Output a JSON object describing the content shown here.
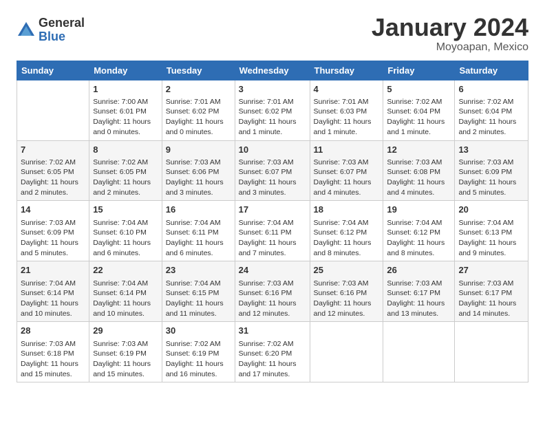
{
  "header": {
    "logo": {
      "general": "General",
      "blue": "Blue"
    },
    "month": "January 2024",
    "location": "Moyoapan, Mexico"
  },
  "weekdays": [
    "Sunday",
    "Monday",
    "Tuesday",
    "Wednesday",
    "Thursday",
    "Friday",
    "Saturday"
  ],
  "weeks": [
    [
      {
        "day": "",
        "info": ""
      },
      {
        "day": "1",
        "info": "Sunrise: 7:00 AM\nSunset: 6:01 PM\nDaylight: 11 hours\nand 0 minutes."
      },
      {
        "day": "2",
        "info": "Sunrise: 7:01 AM\nSunset: 6:02 PM\nDaylight: 11 hours\nand 0 minutes."
      },
      {
        "day": "3",
        "info": "Sunrise: 7:01 AM\nSunset: 6:02 PM\nDaylight: 11 hours\nand 1 minute."
      },
      {
        "day": "4",
        "info": "Sunrise: 7:01 AM\nSunset: 6:03 PM\nDaylight: 11 hours\nand 1 minute."
      },
      {
        "day": "5",
        "info": "Sunrise: 7:02 AM\nSunset: 6:04 PM\nDaylight: 11 hours\nand 1 minute."
      },
      {
        "day": "6",
        "info": "Sunrise: 7:02 AM\nSunset: 6:04 PM\nDaylight: 11 hours\nand 2 minutes."
      }
    ],
    [
      {
        "day": "7",
        "info": "Sunrise: 7:02 AM\nSunset: 6:05 PM\nDaylight: 11 hours\nand 2 minutes."
      },
      {
        "day": "8",
        "info": "Sunrise: 7:02 AM\nSunset: 6:05 PM\nDaylight: 11 hours\nand 2 minutes."
      },
      {
        "day": "9",
        "info": "Sunrise: 7:03 AM\nSunset: 6:06 PM\nDaylight: 11 hours\nand 3 minutes."
      },
      {
        "day": "10",
        "info": "Sunrise: 7:03 AM\nSunset: 6:07 PM\nDaylight: 11 hours\nand 3 minutes."
      },
      {
        "day": "11",
        "info": "Sunrise: 7:03 AM\nSunset: 6:07 PM\nDaylight: 11 hours\nand 4 minutes."
      },
      {
        "day": "12",
        "info": "Sunrise: 7:03 AM\nSunset: 6:08 PM\nDaylight: 11 hours\nand 4 minutes."
      },
      {
        "day": "13",
        "info": "Sunrise: 7:03 AM\nSunset: 6:09 PM\nDaylight: 11 hours\nand 5 minutes."
      }
    ],
    [
      {
        "day": "14",
        "info": "Sunrise: 7:03 AM\nSunset: 6:09 PM\nDaylight: 11 hours\nand 5 minutes."
      },
      {
        "day": "15",
        "info": "Sunrise: 7:04 AM\nSunset: 6:10 PM\nDaylight: 11 hours\nand 6 minutes."
      },
      {
        "day": "16",
        "info": "Sunrise: 7:04 AM\nSunset: 6:11 PM\nDaylight: 11 hours\nand 6 minutes."
      },
      {
        "day": "17",
        "info": "Sunrise: 7:04 AM\nSunset: 6:11 PM\nDaylight: 11 hours\nand 7 minutes."
      },
      {
        "day": "18",
        "info": "Sunrise: 7:04 AM\nSunset: 6:12 PM\nDaylight: 11 hours\nand 8 minutes."
      },
      {
        "day": "19",
        "info": "Sunrise: 7:04 AM\nSunset: 6:12 PM\nDaylight: 11 hours\nand 8 minutes."
      },
      {
        "day": "20",
        "info": "Sunrise: 7:04 AM\nSunset: 6:13 PM\nDaylight: 11 hours\nand 9 minutes."
      }
    ],
    [
      {
        "day": "21",
        "info": "Sunrise: 7:04 AM\nSunset: 6:14 PM\nDaylight: 11 hours\nand 10 minutes."
      },
      {
        "day": "22",
        "info": "Sunrise: 7:04 AM\nSunset: 6:14 PM\nDaylight: 11 hours\nand 10 minutes."
      },
      {
        "day": "23",
        "info": "Sunrise: 7:04 AM\nSunset: 6:15 PM\nDaylight: 11 hours\nand 11 minutes."
      },
      {
        "day": "24",
        "info": "Sunrise: 7:03 AM\nSunset: 6:16 PM\nDaylight: 11 hours\nand 12 minutes."
      },
      {
        "day": "25",
        "info": "Sunrise: 7:03 AM\nSunset: 6:16 PM\nDaylight: 11 hours\nand 12 minutes."
      },
      {
        "day": "26",
        "info": "Sunrise: 7:03 AM\nSunset: 6:17 PM\nDaylight: 11 hours\nand 13 minutes."
      },
      {
        "day": "27",
        "info": "Sunrise: 7:03 AM\nSunset: 6:17 PM\nDaylight: 11 hours\nand 14 minutes."
      }
    ],
    [
      {
        "day": "28",
        "info": "Sunrise: 7:03 AM\nSunset: 6:18 PM\nDaylight: 11 hours\nand 15 minutes."
      },
      {
        "day": "29",
        "info": "Sunrise: 7:03 AM\nSunset: 6:19 PM\nDaylight: 11 hours\nand 15 minutes."
      },
      {
        "day": "30",
        "info": "Sunrise: 7:02 AM\nSunset: 6:19 PM\nDaylight: 11 hours\nand 16 minutes."
      },
      {
        "day": "31",
        "info": "Sunrise: 7:02 AM\nSunset: 6:20 PM\nDaylight: 11 hours\nand 17 minutes."
      },
      {
        "day": "",
        "info": ""
      },
      {
        "day": "",
        "info": ""
      },
      {
        "day": "",
        "info": ""
      }
    ]
  ]
}
